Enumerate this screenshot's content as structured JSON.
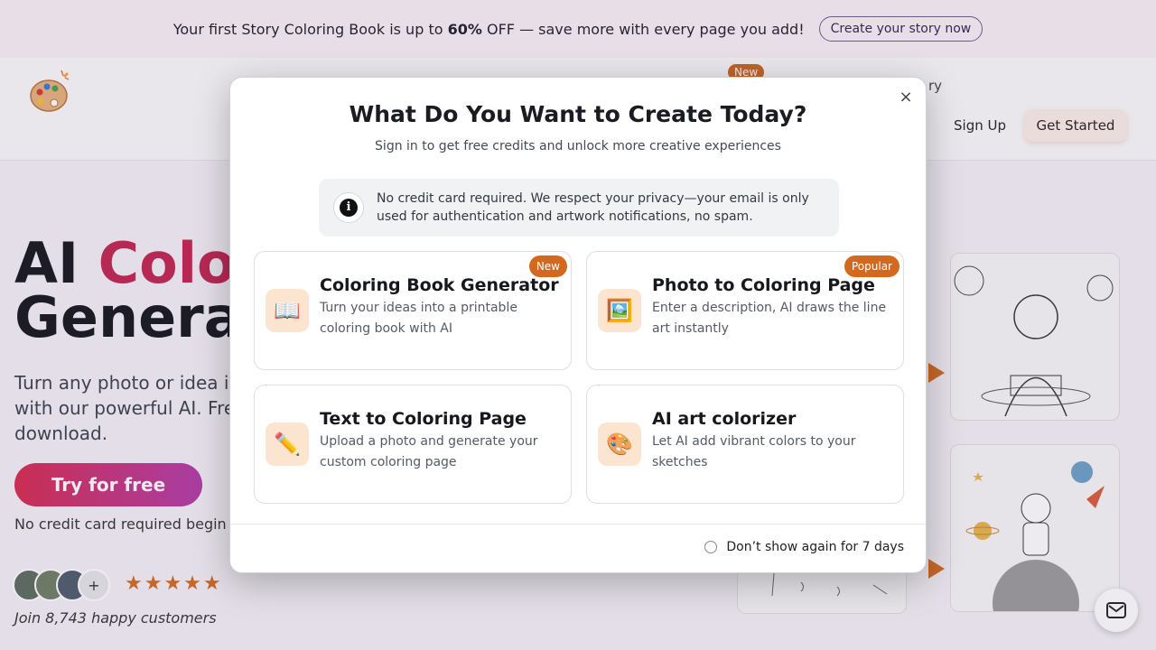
{
  "banner": {
    "text_before": "Your first Story Coloring Book is up to",
    "discount": "60%",
    "text_after": "OFF — save more with every page you add!",
    "cta": "Create your story now"
  },
  "nav": {
    "new_badge": "New",
    "story_link_partial": "ry",
    "sign_up": "Sign Up",
    "get_started": "Get Started"
  },
  "hero": {
    "title_line1_plain": "AI ",
    "title_line1_accent": "Colo",
    "title_line2": "Genera",
    "description": "Turn any photo or idea i with our powerful AI. Fre download.",
    "try_button": "Try for free",
    "no_card_line": "No credit card required begin",
    "avatar_more": "+",
    "stars": "★★★★★",
    "rating": 5,
    "join_text": "Join 8,743 happy customers"
  },
  "modal": {
    "close_glyph": "×",
    "title": "What Do You Want to Create Today?",
    "subtitle": "Sign in to get free credits and unlock more creative experiences",
    "notice_icon_glyph": "i",
    "notice": "No credit card required. We respect your privacy—your email is only used for authentication and artwork notifications, no spam.",
    "options": [
      {
        "title": "Coloring Book Generator",
        "description": "Turn your ideas into a printable coloring book with AI",
        "badge": "New",
        "icon": "book-icon",
        "icon_glyph": "📖"
      },
      {
        "title": "Photo to Coloring Page",
        "description": "Enter a description, AI draws the line art instantly",
        "badge": "Popular",
        "icon": "framed-picture-icon",
        "icon_glyph": "🖼️"
      },
      {
        "title": "Text to Coloring Page",
        "description": "Upload a photo and generate your custom coloring page",
        "badge": "",
        "icon": "pencil-icon",
        "icon_glyph": "✏️"
      },
      {
        "title": "AI art colorizer",
        "description": "Let AI add vibrant colors to your sketches",
        "badge": "",
        "icon": "palette-icon",
        "icon_glyph": "🎨"
      }
    ],
    "dont_show": "Don’t show again for 7 days"
  },
  "colors": {
    "accent_orange": "#d2691e",
    "hero_accent": "#c0234f",
    "icon_tile": "#fbe4d0"
  }
}
